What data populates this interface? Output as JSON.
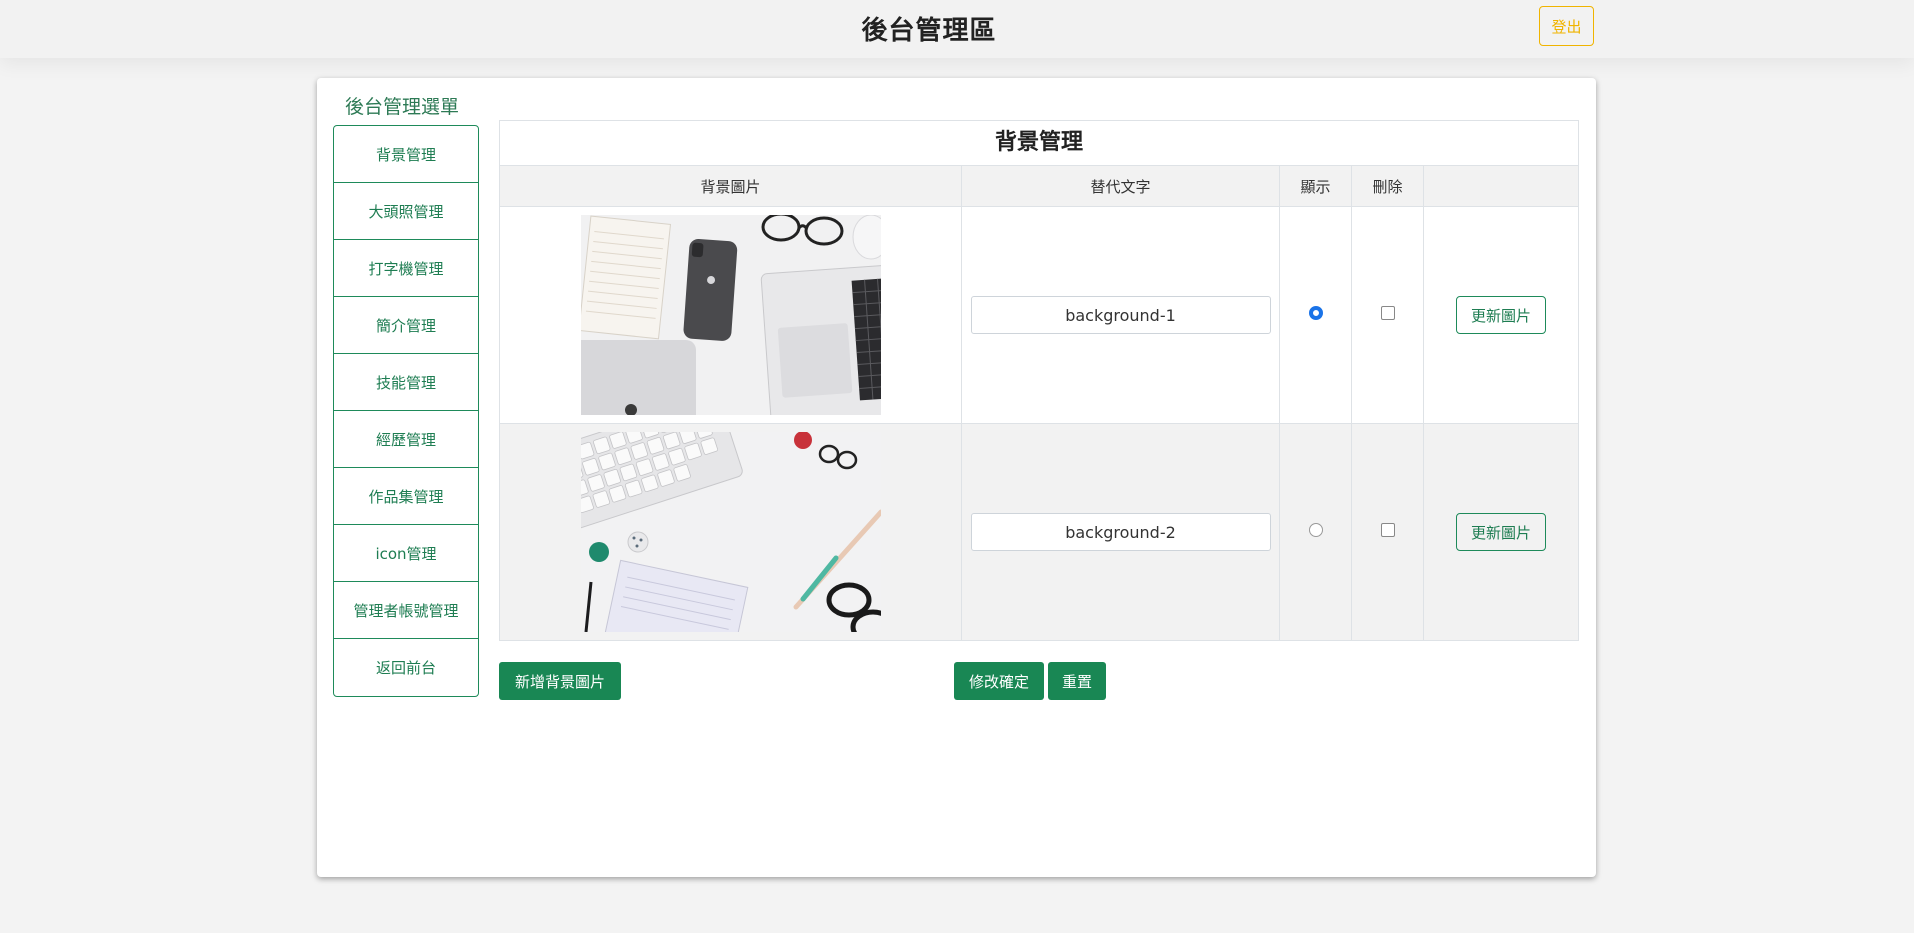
{
  "header": {
    "title": "後台管理區",
    "logout_label": "登出"
  },
  "sidebar": {
    "title": "後台管理選單",
    "items": [
      {
        "label": "背景管理"
      },
      {
        "label": "大頭照管理"
      },
      {
        "label": "打字機管理"
      },
      {
        "label": "簡介管理"
      },
      {
        "label": "技能管理"
      },
      {
        "label": "經歷管理"
      },
      {
        "label": "作品集管理"
      },
      {
        "label": "icon管理"
      },
      {
        "label": "管理者帳號管理"
      },
      {
        "label": "返回前台"
      }
    ]
  },
  "main": {
    "title": "背景管理",
    "columns": [
      "背景圖片",
      "替代文字",
      "顯示",
      "刪除",
      ""
    ],
    "rows": [
      {
        "image": "desk-phone-laptop-photo",
        "alt_text": "background-1",
        "display": true,
        "delete": false,
        "update_label": "更新圖片"
      },
      {
        "image": "keyboard-glasses-notebook-photo",
        "alt_text": "background-2",
        "display": false,
        "delete": false,
        "update_label": "更新圖片"
      }
    ],
    "add_label": "新增背景圖片",
    "confirm_label": "修改確定",
    "reset_label": "重置"
  },
  "colors": {
    "accent": "#198754",
    "logout": "#f0b400",
    "radio": "#1a73e8"
  }
}
